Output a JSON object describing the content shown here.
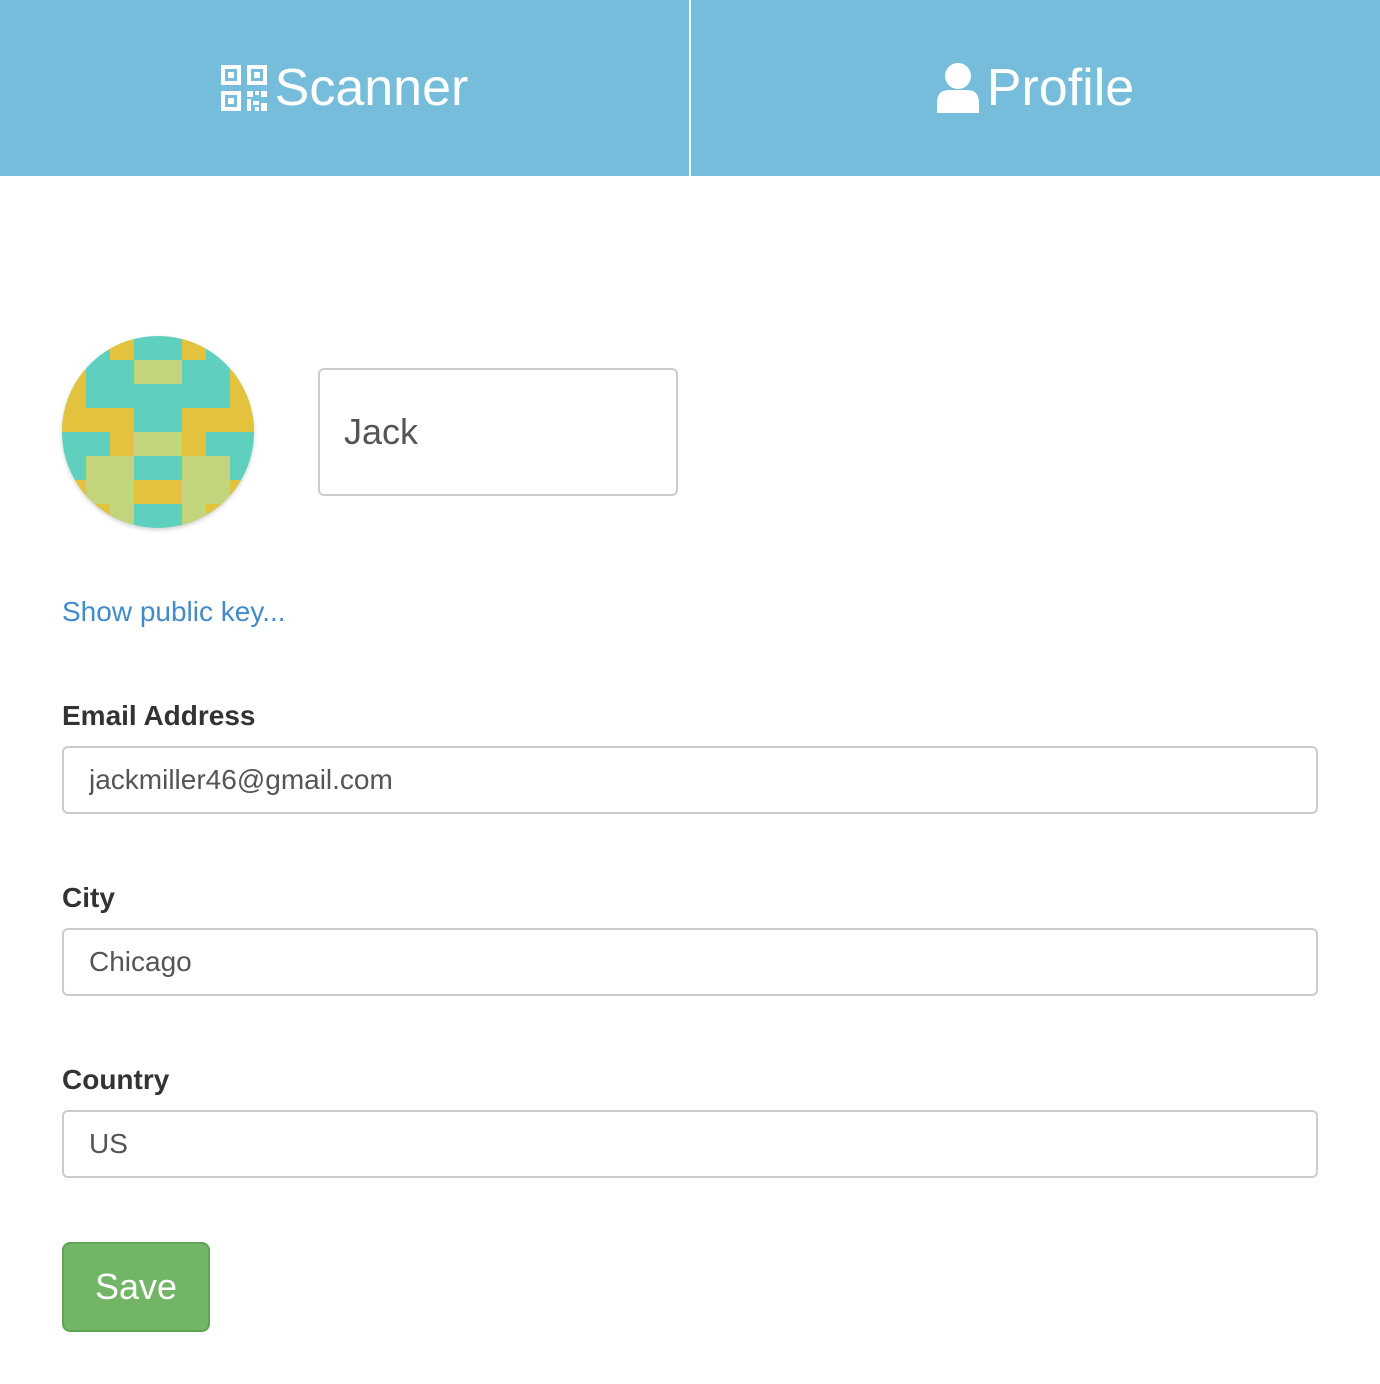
{
  "nav": {
    "tabs": [
      {
        "label": "Scanner",
        "icon": "qr-code-icon"
      },
      {
        "label": "Profile",
        "icon": "user-icon"
      }
    ]
  },
  "profile": {
    "name_value": "Jack",
    "show_key_link": "Show public key...",
    "email": {
      "label": "Email Address",
      "value": "jackmiller46@gmail.com"
    },
    "city": {
      "label": "City",
      "value": "Chicago"
    },
    "country": {
      "label": "Country",
      "value": "US"
    },
    "save_label": "Save"
  },
  "colors": {
    "nav_background": "#75bdda",
    "link": "#428bca",
    "save_button": "#72b567",
    "avatar_teal": "#5fd0bd",
    "avatar_yellow": "#e3c23e",
    "avatar_lime": "#c3d57a"
  }
}
